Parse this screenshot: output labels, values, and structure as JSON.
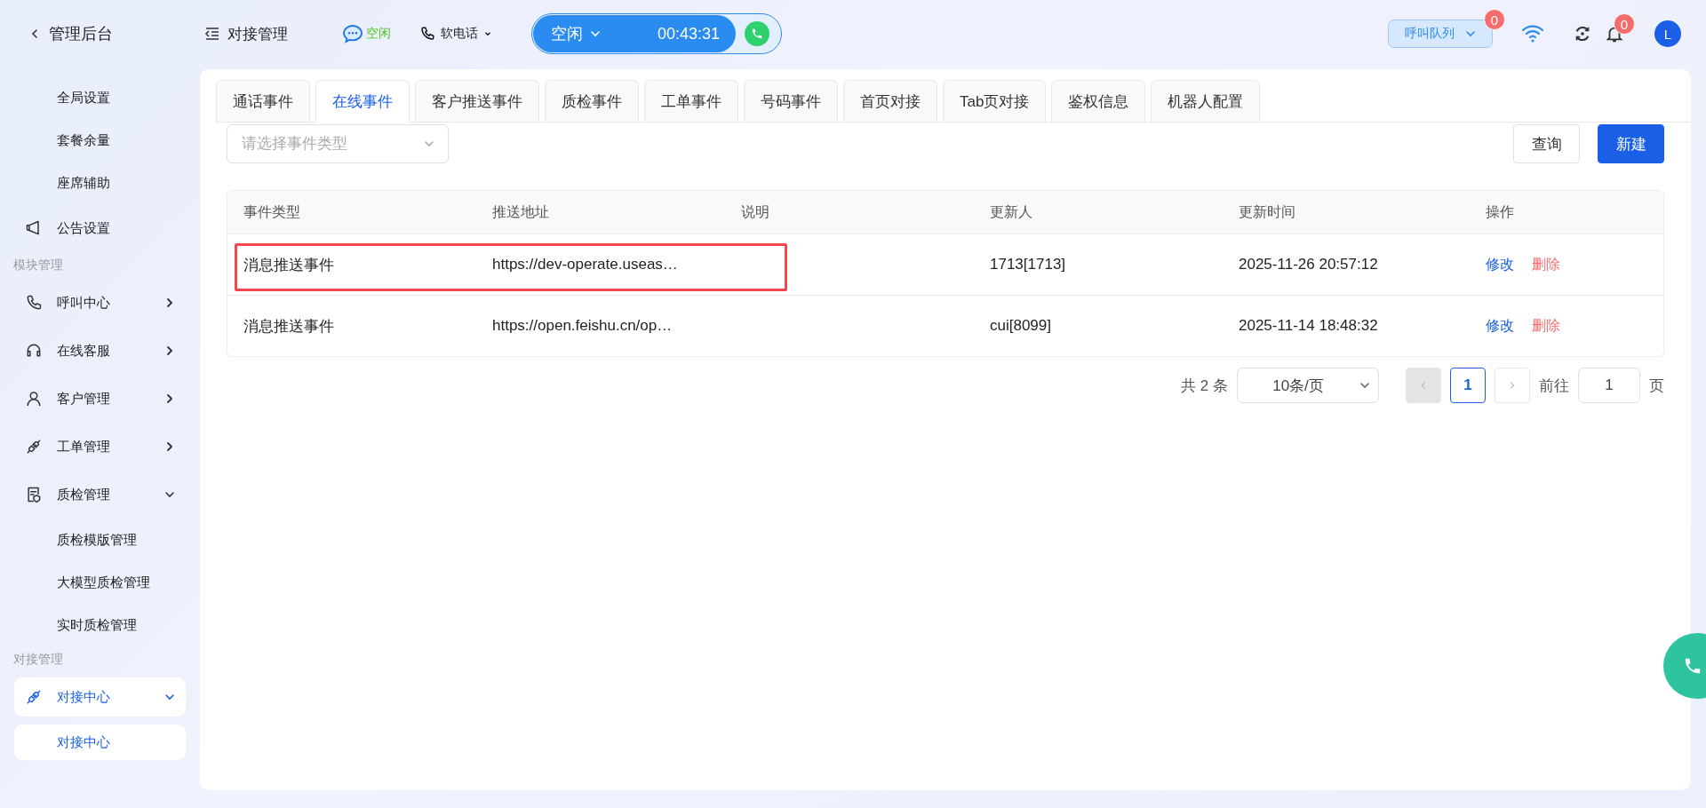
{
  "header": {
    "back_label": "管理后台",
    "page_title": "对接管理",
    "chat_status": "空闲",
    "phone_mode": "软电话",
    "call_status": "空闲",
    "call_timer": "00:43:31",
    "queue_button": "呼叫队列",
    "queue_badge": "0",
    "notification_badge": "0",
    "avatar": "L"
  },
  "sidebar": {
    "items": [
      {
        "kind": "subitem",
        "label": "全局设置",
        "selected": false
      },
      {
        "kind": "subitem",
        "label": "套餐余量",
        "selected": false
      },
      {
        "kind": "subitem",
        "label": "座席辅助",
        "selected": false
      },
      {
        "kind": "item",
        "label": "公告设置",
        "selected": false
      },
      {
        "kind": "section",
        "label": "模块管理"
      },
      {
        "kind": "item",
        "label": "呼叫中心",
        "selected": false,
        "expanded": false
      },
      {
        "kind": "item",
        "label": "在线客服",
        "selected": false,
        "expanded": false
      },
      {
        "kind": "item",
        "label": "客户管理",
        "selected": false,
        "expanded": false
      },
      {
        "kind": "item",
        "label": "工单管理",
        "selected": false,
        "expanded": false
      },
      {
        "kind": "item",
        "label": "质检管理",
        "selected": false,
        "expanded": true,
        "children": [
          {
            "label": "质检模版管理",
            "selected": false
          },
          {
            "label": "大模型质检管理",
            "selected": false
          },
          {
            "label": "实时质检管理",
            "selected": false
          }
        ]
      },
      {
        "kind": "section",
        "label": "对接管理"
      },
      {
        "kind": "item",
        "label": "对接中心",
        "selected": true,
        "expanded": true,
        "children": [
          {
            "label": "对接中心",
            "selected": true
          }
        ]
      }
    ]
  },
  "tabs": [
    {
      "label": "通话事件",
      "selected": false
    },
    {
      "label": "在线事件",
      "selected": true
    },
    {
      "label": "客户推送事件",
      "selected": false
    },
    {
      "label": "质检事件",
      "selected": false
    },
    {
      "label": "工单事件",
      "selected": false
    },
    {
      "label": "号码事件",
      "selected": false
    },
    {
      "label": "首页对接",
      "selected": false
    },
    {
      "label": "Tab页对接",
      "selected": false
    },
    {
      "label": "鉴权信息",
      "selected": false
    },
    {
      "label": "机器人配置",
      "selected": false
    }
  ],
  "filter": {
    "placeholder": "请选择事件类型"
  },
  "buttons": {
    "query": "查询",
    "create": "新建"
  },
  "table": {
    "columns": [
      "事件类型",
      "推送地址",
      "说明",
      "更新人",
      "更新时间",
      "操作"
    ],
    "rows": [
      {
        "event_type": "消息推送事件",
        "url": "https://dev-operate.useas…",
        "updater": "1713[1713]",
        "updated": "2025-11-26 20:57:12",
        "edit": "修改",
        "delete": "删除",
        "highlighted": true
      },
      {
        "event_type": "消息推送事件",
        "url": "https://open.feishu.cn/op…",
        "updater": "cui[8099]",
        "updated": "2025-11-14 18:48:32",
        "edit": "修改",
        "delete": "删除",
        "highlighted": false
      }
    ]
  },
  "pagination": {
    "total": "共 2 条",
    "page_size": "10条/页",
    "pages": [
      {
        "label": "1",
        "selected": true
      }
    ],
    "goto_label": "前往",
    "goto_value": "1",
    "page_suffix": "页"
  }
}
